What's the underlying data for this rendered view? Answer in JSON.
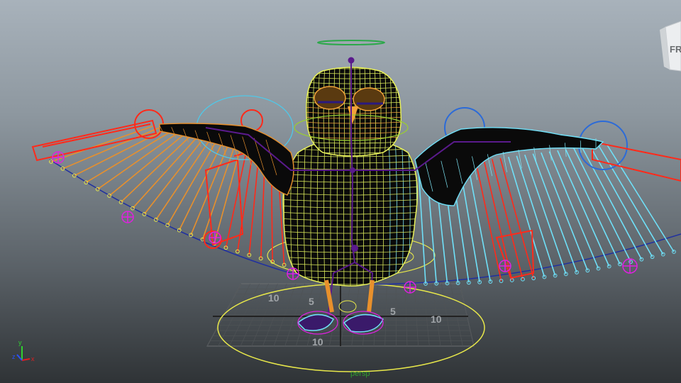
{
  "view_cube": {
    "face_label": "FR"
  },
  "axis_gizmo": {
    "y_label": "y",
    "z_label": "z",
    "x_label": "x"
  },
  "grid": {
    "labels": [
      "10",
      "5",
      "5",
      "10",
      "10"
    ]
  },
  "camera": {
    "name": "persp"
  },
  "colors": {
    "left_control": "#ff2a1a",
    "right_control": "#2c6bd8",
    "left_joint": "#e8902c",
    "right_joint": "#6fe0f8",
    "center_joint": "#5a1a8c",
    "mesh_body": "#d9e85a",
    "mesh_face": "#f2a23a",
    "mesh_right": "#7fe8f8",
    "ground_control": "#e8e84a",
    "magenta_locator": "#e020e0",
    "wing_curve": "#2030a0"
  }
}
